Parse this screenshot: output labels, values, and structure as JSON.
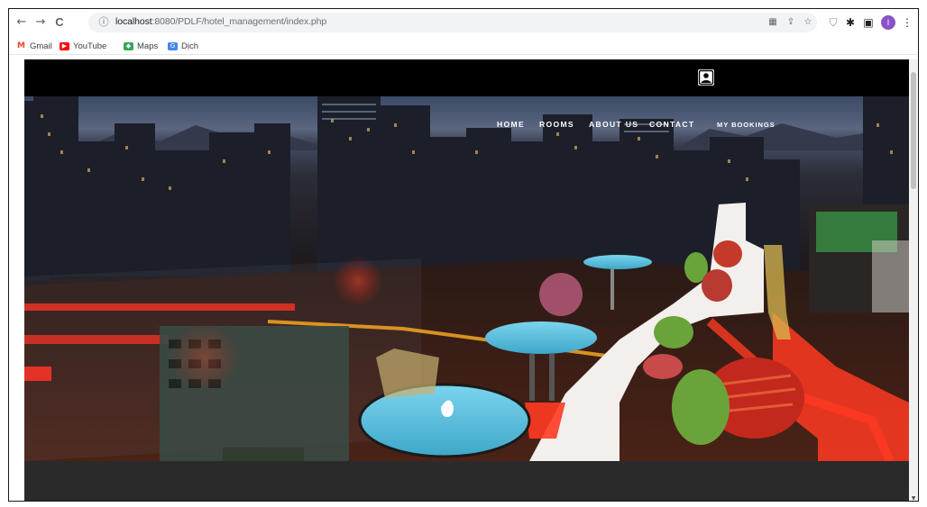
{
  "browser": {
    "back_glyph": "←",
    "forward_glyph": "→",
    "reload_glyph": "C",
    "info_glyph": "ⓘ",
    "url_host": "localhost",
    "url_path": ":8080/PDLF/hotel_management/index.php",
    "menu_glyph": "⋮",
    "profile_initial": "I",
    "icons": [
      "translate-icon",
      "share-icon",
      "star-icon",
      "shield-extension-icon",
      "puzzle-extensions-icon",
      "side-panel-icon"
    ]
  },
  "bookmarks": [
    {
      "label": "Gmail",
      "icon": "gmail-icon",
      "color": "#ea4335",
      "glyph": "M"
    },
    {
      "label": "YouTube",
      "icon": "youtube-icon",
      "color": "#ff0000",
      "glyph": "▶"
    },
    {
      "label": "Maps",
      "icon": "maps-icon",
      "color": "#34a853",
      "glyph": "◆"
    },
    {
      "label": "Dịch",
      "icon": "translate-icon",
      "color": "#4285f4",
      "glyph": "G"
    }
  ],
  "site": {
    "nav": [
      {
        "label": "HOME"
      },
      {
        "label": "ROOMS"
      },
      {
        "label": "ABOUT US"
      },
      {
        "label": "CONTACT"
      },
      {
        "label": "MY BOOKINGS"
      }
    ],
    "user_icon": "user-account-icon"
  },
  "colors": {
    "header_bg": "#000000",
    "footer_bg": "#2a2a2a",
    "table_top": "#56bcd9",
    "neon_red": "#ff2a1a"
  }
}
